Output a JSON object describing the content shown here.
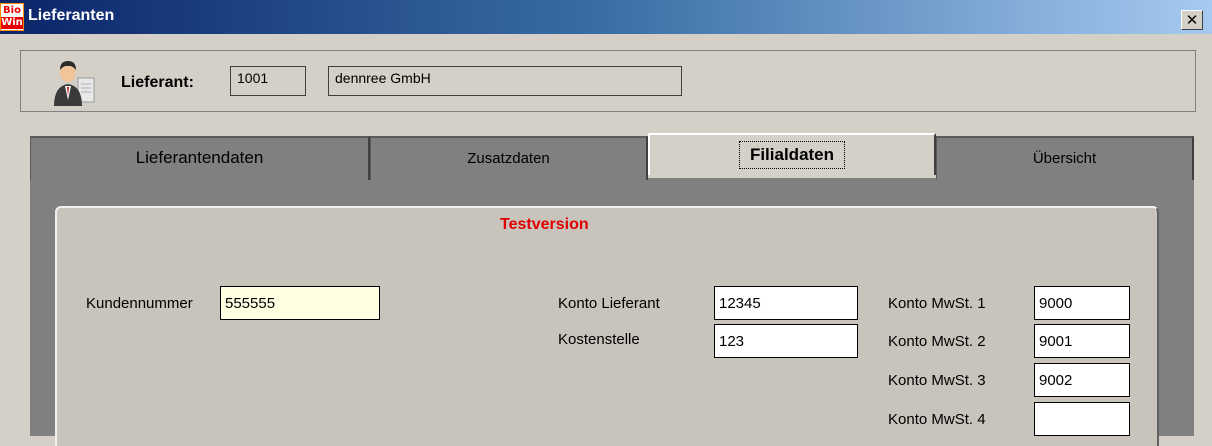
{
  "window": {
    "title": "Lieferanten",
    "app_icon_text_top": "Bio",
    "app_icon_text_bottom": "Win",
    "close_symbol": "✕"
  },
  "header": {
    "label": "Lieferant:",
    "supplier_number": "1001",
    "supplier_name": "dennree GmbH",
    "icon": "user-icon"
  },
  "tabs": [
    {
      "label": "Lieferantendaten",
      "active": false
    },
    {
      "label": "Zusatzdaten",
      "active": false
    },
    {
      "label": "Filialdaten",
      "active": true
    },
    {
      "label": "Übersicht",
      "active": false
    }
  ],
  "panel": {
    "watermark": "Testversion",
    "kundennummer_label": "Kundennummer",
    "kundennummer_value": "555555",
    "konto_lieferant_label": "Konto Lieferant",
    "konto_lieferant_value": "12345",
    "kostenstelle_label": "Kostenstelle",
    "kostenstelle_value": "123",
    "mwst": [
      {
        "label": "Konto MwSt. 1",
        "value": "9000"
      },
      {
        "label": "Konto MwSt. 2",
        "value": "9001"
      },
      {
        "label": "Konto MwSt. 3",
        "value": "9002"
      },
      {
        "label": "Konto MwSt. 4",
        "value": ""
      }
    ]
  },
  "colors": {
    "titlebar_start": "#0a246a",
    "titlebar_end": "#a6caf0",
    "watermark": "#e00000",
    "highlight_field": "#ffffe1"
  }
}
